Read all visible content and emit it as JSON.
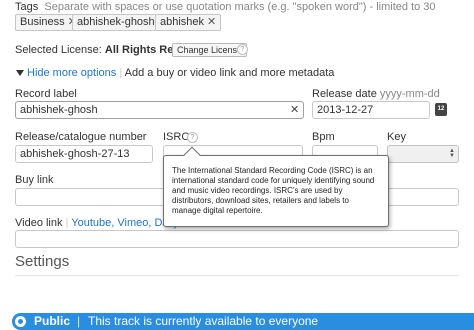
{
  "tags": {
    "label": "Tags",
    "hint": "Separate with spaces or use quotation marks (e.g. \"spoken word\") - limited to 30",
    "chips": [
      "Business",
      "abhishek-ghosh",
      "abhishek"
    ],
    "remove_glyph": "✕"
  },
  "license": {
    "label": "Selected License:",
    "value": "All Rights Reserved",
    "change_button": "Change License",
    "help": "?"
  },
  "metadata_toggle": {
    "link": "Hide more options",
    "text": "Add a buy or video link and more metadata"
  },
  "record_label": {
    "label": "Record label",
    "value": "abhishek-ghosh",
    "clear_glyph": "✕"
  },
  "release_date": {
    "label": "Release date",
    "hint": "yyyy-mm-dd",
    "value": "2013-12-27",
    "calendar_text": "12"
  },
  "catalogue": {
    "label": "Release/catalogue number",
    "value": "abhishek-ghosh-27-13"
  },
  "isrc": {
    "label": "ISRC",
    "help": "?"
  },
  "bpm": {
    "label": "Bpm"
  },
  "key": {
    "label": "Key"
  },
  "buy_link": {
    "label": "Buy link"
  },
  "video_link": {
    "label": "Video link",
    "services": "Youtube, Vimeo, Dailymo"
  },
  "tooltip": {
    "text": "The International Standard Recording Code (ISRC) is an international standard code for uniquely identifying sound and music video recordings. ISRC's are used by distributors, download sites, retailers and labels to manage digital repertoire."
  },
  "settings": {
    "heading": "Settings",
    "public_label": "Public",
    "public_desc": "This track is currently available to everyone"
  },
  "colors": {
    "accent": "#2a8ee0",
    "link": "#1877c9"
  }
}
